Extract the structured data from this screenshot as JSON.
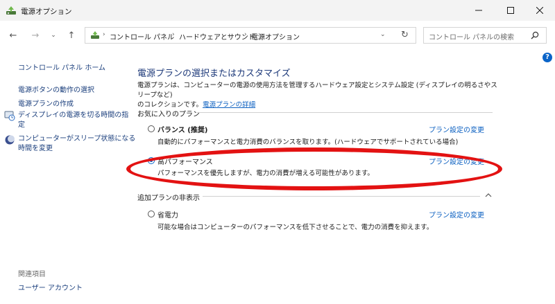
{
  "window": {
    "title": "電源オプション"
  },
  "address": {
    "crumbs": [
      "コントロール パネル",
      "ハードウェアとサウンド",
      "電源オプション"
    ],
    "search_placeholder": "コントロール パネルの検索"
  },
  "sidebar": {
    "home": "コントロール パネル ホーム",
    "links": [
      "電源ボタンの動作の選択",
      "電源プランの作成",
      "ディスプレイの電源を切る時間の指定",
      "コンピューターがスリープ状態になる時間を変更"
    ],
    "display_line1": "ディスプレイの電源を切る時間の指",
    "display_line2": "定",
    "sleep_line1": "コンピューターがスリープ状態になる",
    "sleep_line2": "時間を変更",
    "related_label": "関連項目",
    "user_account": "ユーザー アカウント"
  },
  "main": {
    "title": "電源プランの選択またはカスタマイズ",
    "desc_line1": "電源プランは、コンピューターの電源の使用方法を管理するハードウェア設定とシステム設定 (ディスプレイの明るさやスリープなど)",
    "desc_line2": "のコレクションです。",
    "desc_link": "電源プランの詳細",
    "favorites_label": "お気に入りのプラン",
    "hidden_label": "追加プランの非表示",
    "change_label": "プラン設定の変更",
    "plans": [
      {
        "name": "バランス (推奨)",
        "desc": "自動的にパフォーマンスと電力消費のバランスを取ります。(ハードウェアでサポートされている場合)",
        "selected": false
      },
      {
        "name": "高パフォーマンス",
        "desc": "パフォーマンスを優先しますが、電力の消費が増える可能性があります。",
        "selected": true
      },
      {
        "name": "省電力",
        "desc": "可能な場合はコンピューターのパフォーマンスを低下させることで、電力の消費を抑えます。",
        "selected": false
      }
    ]
  },
  "colors": {
    "link": "#0a5fc0",
    "title": "#1e3a7a",
    "annotation": "#e31212"
  }
}
